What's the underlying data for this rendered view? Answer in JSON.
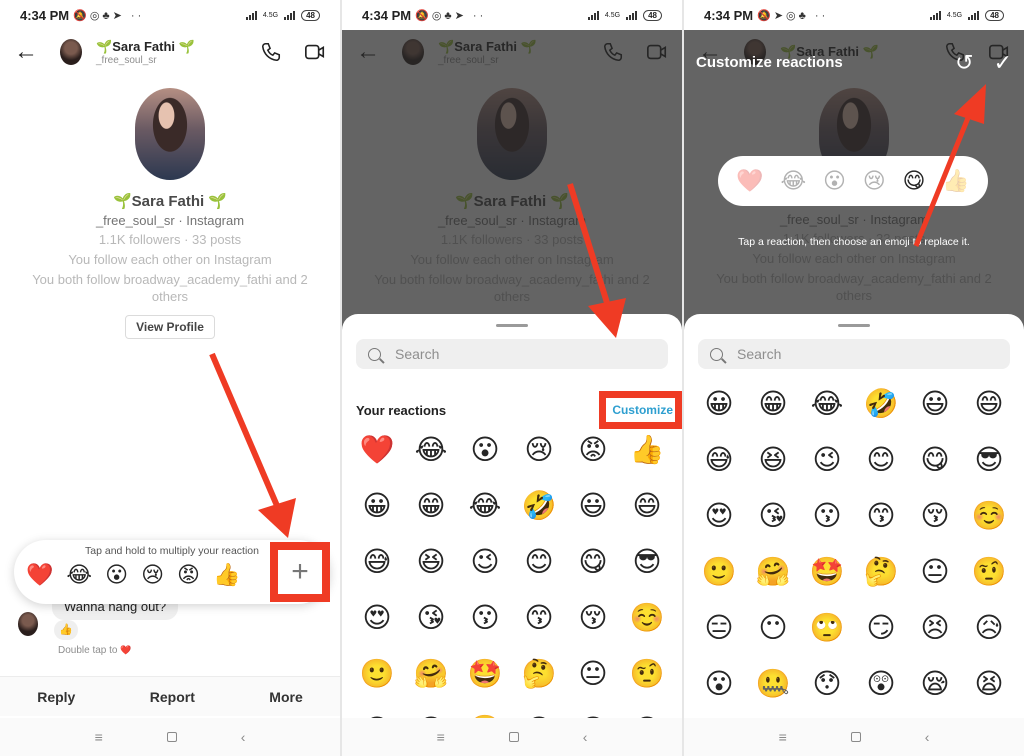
{
  "status_bar": {
    "time": "4:34 PM",
    "network": "4.5G",
    "battery": "48"
  },
  "chat_header": {
    "display_name": "Sara Fathi",
    "name_decoration": "🌱",
    "username": "_free_soul_sr",
    "back_icon": "arrow-left-icon",
    "call_icon": "phone-icon",
    "video_icon": "video-camera-icon"
  },
  "profile": {
    "name": "Sara Fathi",
    "subtitle": "_free_soul_sr · Instagram",
    "stats": "1.1K followers · 33 posts",
    "mutual_line_1": "You follow each other on Instagram",
    "mutual_line_2": "You both follow broadway_academy_fathi and 2 others",
    "view_profile_label": "View Profile"
  },
  "panel1": {
    "reaction_hint": "Tap and hold to multiply your reaction",
    "reactions": [
      "❤️",
      "😂",
      "😮",
      "😢",
      "😡",
      "👍"
    ],
    "add_reaction_label": "+",
    "message_text": "Wanna hang out?",
    "message_reaction": "👍",
    "double_tap_hint": "Double tap to",
    "double_tap_emoji": "❤️",
    "actions": {
      "reply": "Reply",
      "report": "Report",
      "more": "More"
    }
  },
  "panel2": {
    "search_placeholder": "Search",
    "section_title": "Your reactions",
    "customize_label": "Customize",
    "your_reactions": [
      "❤️",
      "😂",
      "😮",
      "😢",
      "😡",
      "👍"
    ],
    "emoji_grid": [
      "😀",
      "😁",
      "😂",
      "🤣",
      "😃",
      "😄",
      "😅",
      "😆",
      "😉",
      "😊",
      "😋",
      "😎",
      "😍",
      "😘",
      "😗",
      "😙",
      "😚",
      "☺️",
      "🙂",
      "🤗",
      "🤩",
      "🤔",
      "😐",
      "🤨",
      "😑",
      "😶",
      "🙄",
      "😏",
      "😣",
      "😥"
    ]
  },
  "panel3": {
    "title": "Customize reactions",
    "reset_icon": "undo-icon",
    "confirm_icon": "checkmark-icon",
    "current_reactions": [
      "❤️",
      "😂",
      "😮",
      "😢",
      "😋",
      "👍"
    ],
    "selected_index": 4,
    "hint": "Tap a reaction, then choose an emoji to replace it.",
    "search_placeholder": "Search",
    "emoji_grid": [
      "😀",
      "😁",
      "😂",
      "🤣",
      "😃",
      "😄",
      "😅",
      "😆",
      "😉",
      "😊",
      "😋",
      "😎",
      "😍",
      "😘",
      "😗",
      "😙",
      "😚",
      "☺️",
      "🙂",
      "🤗",
      "🤩",
      "🤔",
      "😐",
      "🤨",
      "😑",
      "😶",
      "🙄",
      "😏",
      "😣",
      "😥",
      "😮",
      "🤐",
      "😯",
      "😲",
      "😪",
      "😫"
    ]
  },
  "nav_bar": {
    "menu": "≡",
    "home": "",
    "back": "‹"
  },
  "annotation_color": "#ef3b24"
}
